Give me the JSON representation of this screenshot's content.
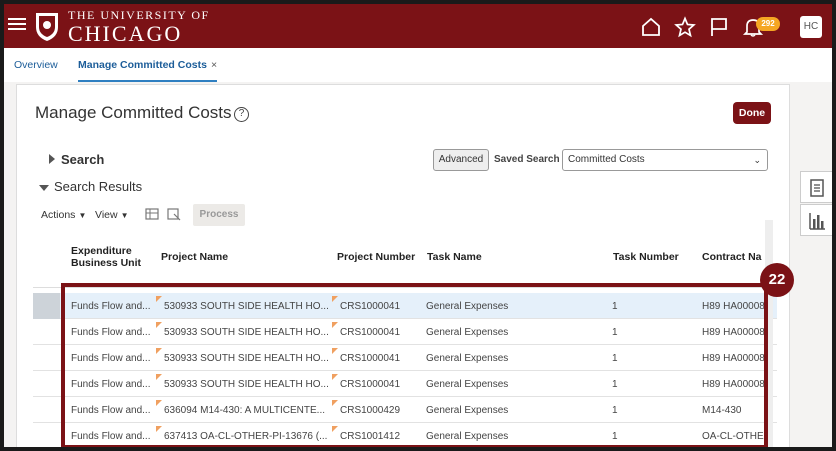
{
  "header": {
    "logo_top": "THE UNIVERSITY OF",
    "logo_main": "CHICAGO",
    "notification_count": "292",
    "avatar_initials": "HC",
    "icons": [
      "home-icon",
      "star-icon",
      "flag-icon",
      "bell-icon"
    ]
  },
  "tabs": [
    {
      "label": "Overview"
    },
    {
      "label": "Manage Committed Costs",
      "close": "×"
    }
  ],
  "page": {
    "title": "Manage Committed Costs",
    "help": "?",
    "done": "Done"
  },
  "search": {
    "label": "Search",
    "advanced": "Advanced",
    "saved_search_label": "Saved Search",
    "saved_search_value": "Committed Costs"
  },
  "results": {
    "label": "Search Results",
    "actions": "Actions",
    "view": "View",
    "process": "Process"
  },
  "table": {
    "columns": [
      "Expenditure Business Unit",
      "Project Name",
      "Project Number",
      "Task Name",
      "Task Number",
      "Contract Na"
    ],
    "rows": [
      {
        "bu": "Funds Flow and...",
        "project_name": "530933 SOUTH SIDE HEALTH HO...",
        "project_number": "CRS1000041",
        "task_name": "General Expenses",
        "task_number": "1",
        "contract": "H89 HA00008"
      },
      {
        "bu": "Funds Flow and...",
        "project_name": "530933 SOUTH SIDE HEALTH HO...",
        "project_number": "CRS1000041",
        "task_name": "General Expenses",
        "task_number": "1",
        "contract": "H89 HA00008"
      },
      {
        "bu": "Funds Flow and...",
        "project_name": "530933 SOUTH SIDE HEALTH HO...",
        "project_number": "CRS1000041",
        "task_name": "General Expenses",
        "task_number": "1",
        "contract": "H89 HA00008"
      },
      {
        "bu": "Funds Flow and...",
        "project_name": "530933 SOUTH SIDE HEALTH HO...",
        "project_number": "CRS1000041",
        "task_name": "General Expenses",
        "task_number": "1",
        "contract": "H89 HA00008"
      },
      {
        "bu": "Funds Flow and...",
        "project_name": "636094 M14-430: A MULTICENTE...",
        "project_number": "CRS1000429",
        "task_name": "General Expenses",
        "task_number": "1",
        "contract": "M14-430"
      },
      {
        "bu": "Funds Flow and...",
        "project_name": "637413 OA-CL-OTHER-PI-13676 (...",
        "project_number": "CRS1001412",
        "task_name": "General Expenses",
        "task_number": "1",
        "contract": "OA-CL-OTHE"
      }
    ]
  },
  "callout": {
    "number": "22"
  },
  "colors": {
    "brand": "#7b1216",
    "badge": "#f5a623",
    "link": "#1c5d99"
  }
}
